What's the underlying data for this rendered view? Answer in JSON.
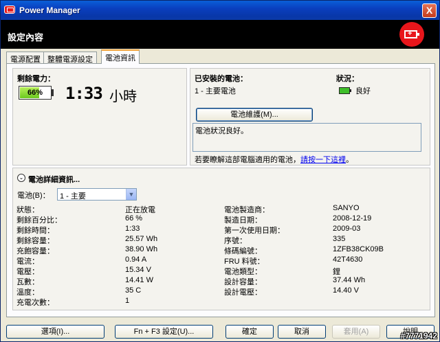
{
  "window": {
    "title": "Power Manager",
    "close_label": "X"
  },
  "header": {
    "title": "設定內容",
    "badge_icon": "battery-plus-icon"
  },
  "tabs": [
    {
      "label": "電源配置",
      "active": false
    },
    {
      "label": "整體電源設定",
      "active": false
    },
    {
      "label": "電池資訊",
      "active": true
    }
  ],
  "remaining": {
    "label": "剩餘電力：",
    "percent_text": "66%",
    "percent_value": 66,
    "time": "1:33",
    "time_unit": "小時"
  },
  "installed": {
    "label": "已安裝的電池：",
    "value": "1 - 主要電池",
    "status_label": "狀況：",
    "status_value": "良好",
    "maintenance_button": "電池維護(M)...",
    "message": "電池狀況良好。",
    "help_text": "若要瞭解這部電腦適用的電池，",
    "help_link": "請按一下這裡",
    "help_suffix": "。"
  },
  "details": {
    "title": "電池詳細資訊...",
    "battery_select_label": "電池(B)：",
    "battery_select_value": "1 - 主要",
    "left": [
      {
        "label": "狀態：",
        "value": "正在放電"
      },
      {
        "label": "剩餘百分比：",
        "value": "66 %"
      },
      {
        "label": "剩餘時間：",
        "value": "1:33"
      },
      {
        "label": "剩餘容量：",
        "value": "25.57 Wh"
      },
      {
        "label": "充飽容量：",
        "value": "38.90 Wh"
      },
      {
        "label": "電流：",
        "value": "0.94 A"
      },
      {
        "label": "電壓：",
        "value": "15.34 V"
      },
      {
        "label": "瓦數：",
        "value": "14.41 W"
      },
      {
        "label": "溫度：",
        "value": "35 C"
      },
      {
        "label": "充電次數：",
        "value": "1"
      }
    ],
    "right": [
      {
        "label": "電池製造商：",
        "value": "SANYO"
      },
      {
        "label": "製造日期：",
        "value": "2008-12-19"
      },
      {
        "label": "第一次使用日期：",
        "value": "2009-03"
      },
      {
        "label": "序號：",
        "value": "335"
      },
      {
        "label": "條碼編號：",
        "value": "1ZFB38CK09B"
      },
      {
        "label": "FRU 料號：",
        "value": "42T4630"
      },
      {
        "label": "電池類型：",
        "value": "鋰"
      },
      {
        "label": "設計容量：",
        "value": "37.44 Wh"
      },
      {
        "label": "設計電壓：",
        "value": "14.40 V"
      }
    ]
  },
  "buttons": {
    "options": "選項(I)...",
    "fn_f3": "Fn + F3 設定(U)...",
    "ok": "確定",
    "cancel": "取消",
    "apply": "套用(A)",
    "help": "說明"
  },
  "watermark": "#7771942"
}
